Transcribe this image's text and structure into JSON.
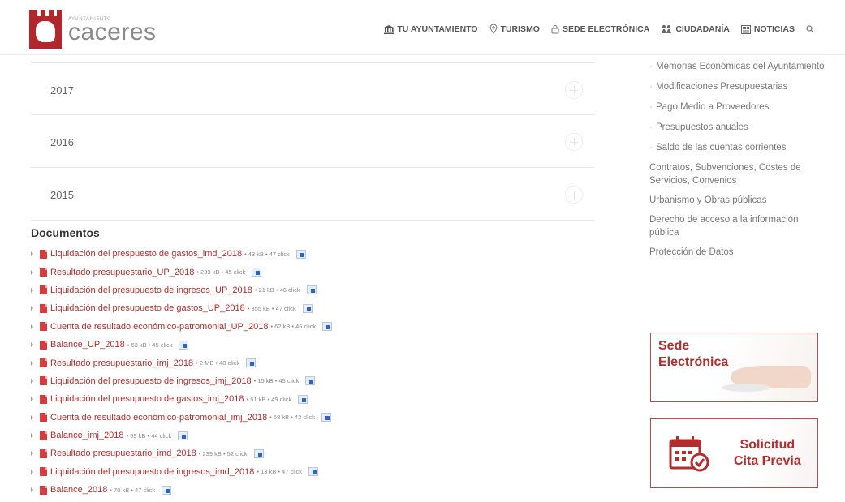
{
  "logo": {
    "small_text": "AYUNTAMIENTO",
    "big_text": "caceres"
  },
  "nav": {
    "items": [
      {
        "label": "TU AYUNTAMIENTO",
        "icon": "bank-icon"
      },
      {
        "label": "TURISMO",
        "icon": "map-pin-icon"
      },
      {
        "label": "SEDE ELECTRÓNICA",
        "icon": "lock-icon"
      },
      {
        "label": "CIUDADANÍA",
        "icon": "people-icon"
      },
      {
        "label": "NOTICIAS",
        "icon": "newspaper-icon"
      }
    ],
    "search_icon": "search-icon"
  },
  "accordion": {
    "items": [
      "2017",
      "2016",
      "2015"
    ]
  },
  "documents": {
    "title": "Documentos",
    "items": [
      {
        "name": "Liquidación del prespuesto de gastos_imd_2018",
        "meta": "• 43 kB • 47 click"
      },
      {
        "name": "Resultado presupuestario_UP_2018",
        "meta": "• 239 kB • 45 click"
      },
      {
        "name": "Liquidación del presupuesto de ingresos_UP_2018",
        "meta": "• 21 kB • 46 click"
      },
      {
        "name": "Liquidación del presupuesto de gastos_UP_2018",
        "meta": "• 355 kB • 47 click"
      },
      {
        "name": "Cuenta de resultado económico-patromonial_UP_2018",
        "meta": "• 62 kB • 45 click"
      },
      {
        "name": "Balance_UP_2018",
        "meta": "• 63 kB • 45 click"
      },
      {
        "name": "Resultado presupuestario_imj_2018",
        "meta": "• 2 MB • 48 click"
      },
      {
        "name": "Liquidación del presupuesto de ingresos_imj_2018",
        "meta": "• 15 kB • 45 click"
      },
      {
        "name": "Liquidación del presupuesto de gastos_imj_2018",
        "meta": "• 51 kB • 49 click"
      },
      {
        "name": "Cuenta de resultado económico-patromonial_imj_2018",
        "meta": "• 58 kB • 43 click"
      },
      {
        "name": "Balance_imj_2018",
        "meta": "• 59 kB • 44 click"
      },
      {
        "name": "Resultado presupuestario_imd_2018",
        "meta": "• 239 kB • 52 click"
      },
      {
        "name": "Liquidación del presupuesto de ingresos_imd_2018",
        "meta": "• 13 kB • 47 click"
      },
      {
        "name": "Balance_2018",
        "meta": "• 70 kB • 47 click"
      }
    ]
  },
  "sidebar": {
    "sub_items": [
      "Memorias Económicas del Ayuntamiento",
      "Modificaciones Presupuestarias",
      "Pago Medio a Proveedores",
      "Presupuestos anuales",
      "Saldo de las cuentas corrientes"
    ],
    "top_items": [
      "Contratos, Subvenciones, Costes de Servicios, Convenios",
      "Urbanismo y Obras públicas",
      "Derecho de acceso a la información pública",
      "Protección de Datos"
    ]
  },
  "banners": {
    "sede": {
      "line1": "Sede",
      "line2": "Electrónica"
    },
    "cita": {
      "line1": "Solicitud",
      "line2": "Cita Previa"
    }
  },
  "colors": {
    "accent": "#b42c2c",
    "brand_red": "#b3262b"
  }
}
